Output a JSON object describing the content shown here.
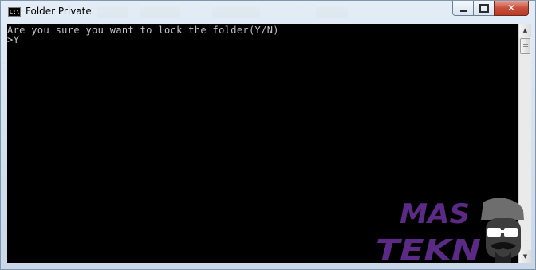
{
  "window": {
    "title": "Folder Private",
    "icon": "cmd-icon",
    "icon_text": "C:\\."
  },
  "controls": {
    "minimize": "minimize-icon",
    "maximize": "maximize-icon",
    "close_glyph": "✕"
  },
  "console": {
    "lines": [
      "Are you sure you want to lock the folder(Y/N)",
      ">Y"
    ]
  },
  "scrollbar": {
    "up_glyph": "▲",
    "down_glyph": "▼"
  },
  "watermark": {
    "line1": "MAS",
    "line2": "TEKN",
    "colors": {
      "purple": "#5b2a86",
      "glasses": "#ffffff"
    }
  }
}
